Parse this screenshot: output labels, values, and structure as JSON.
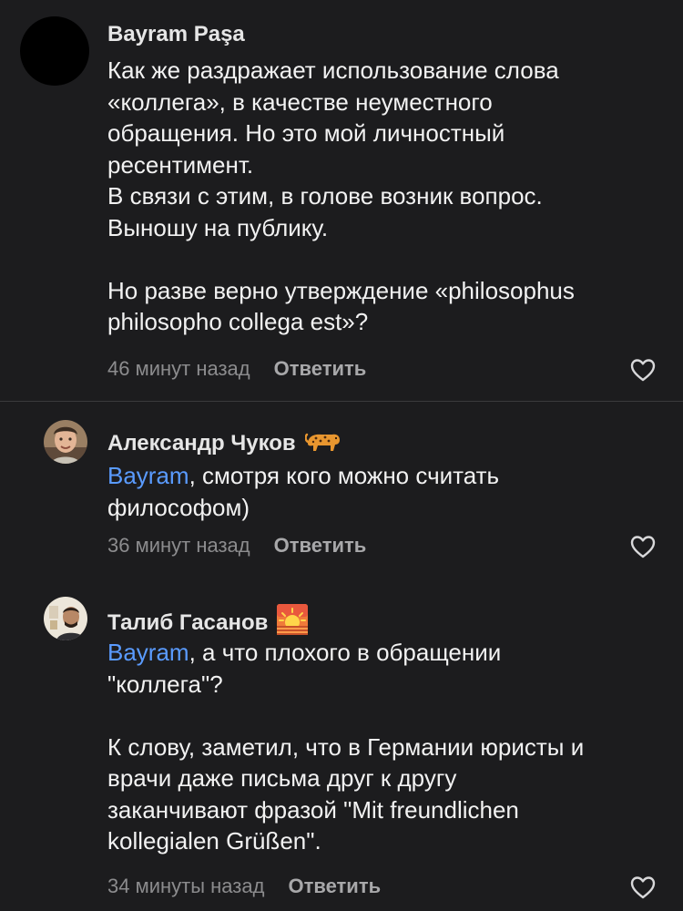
{
  "comments": [
    {
      "author": "Bayram Paşa",
      "lines": [
        "Как же раздражает использование слова",
        "«коллега», в качестве неуместного",
        "обращения. Но это мой личностный",
        "ресентимент.",
        "В связи с этим, в голове возник вопрос.",
        "Выношу на публику.",
        "",
        "Но разве верно утверждение «philosophus",
        "philosopho collega est»?"
      ],
      "time": "46 минут назад",
      "reply": "Ответить"
    },
    {
      "author": "Александр Чуков",
      "author_emoji": "leopard-emoji",
      "mention": "Bayram",
      "lines": [
        ", смотря кого можно считать",
        "философом)"
      ],
      "time": "36 минут назад",
      "reply": "Ответить"
    },
    {
      "author": "Талиб Гасанов",
      "author_emoji": "sunrise-emoji",
      "mention": "Bayram",
      "lines": [
        ", а что плохого в обращении",
        "\"коллега\"?",
        "",
        "К слову, заметил, что в Германии юристы и",
        "врачи даже письма друг к другу",
        "заканчивают фразой \"Mit freundlichen",
        "kollegialen Grüßen\"."
      ],
      "time": "34 минуты назад",
      "reply": "Ответить"
    }
  ],
  "icons": {
    "like": "heart-outline-icon"
  },
  "colors": {
    "background": "#1c1c1e",
    "mention": "#5a9bff",
    "meta": "#8c8c8e",
    "divider": "#3a3a3c"
  }
}
